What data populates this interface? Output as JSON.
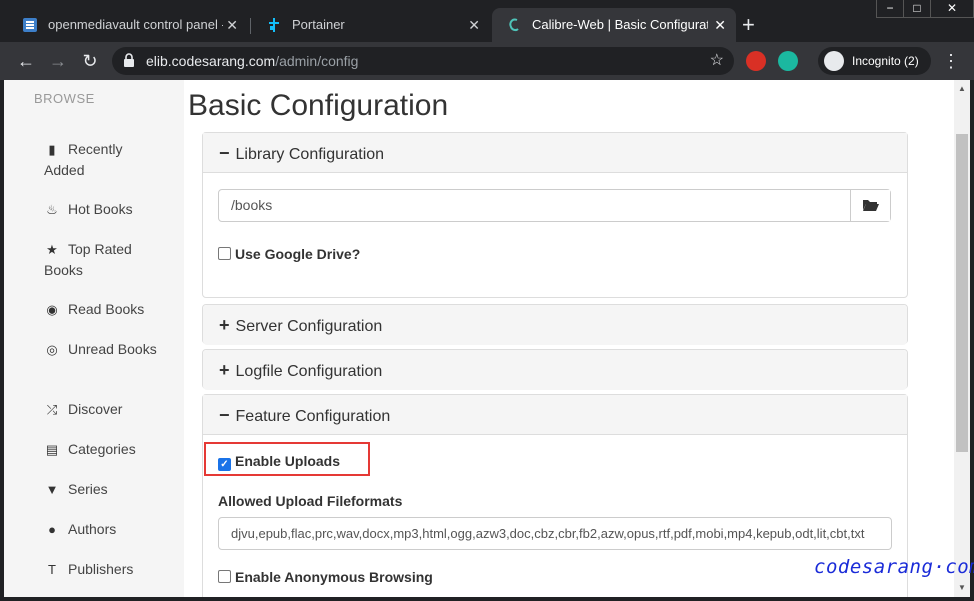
{
  "window_controls": {
    "minimize": "−",
    "maximize": "□",
    "close": "✕"
  },
  "tabs": [
    {
      "title": "openmediavault control panel - c",
      "icon": "omv-icon"
    },
    {
      "title": "Portainer",
      "icon": "portainer-icon"
    },
    {
      "title": "Calibre-Web | Basic Configuration",
      "icon": "calibre-icon"
    }
  ],
  "tab_close": "✕",
  "new_tab": "+",
  "toolbar": {
    "back": "←",
    "forward": "→",
    "reload": "↻",
    "url_host": "elib.codesarang.com",
    "url_path": "/admin/config",
    "star": "☆",
    "incognito_label": "Incognito (2)",
    "menu": "⋮"
  },
  "sidebar": {
    "heading": "BROWSE",
    "items": [
      {
        "label": "Recently Added",
        "icon": "book-icon",
        "glyph": "▮"
      },
      {
        "label": "Hot Books",
        "icon": "fire-icon",
        "glyph": "♨"
      },
      {
        "label": "Top Rated Books",
        "icon": "star-icon",
        "glyph": "★"
      },
      {
        "label": "Read Books",
        "icon": "eye-icon",
        "glyph": "◉"
      },
      {
        "label": "Unread Books",
        "icon": "eye-slash-icon",
        "glyph": "◎"
      },
      {
        "label": "Discover",
        "icon": "shuffle-icon",
        "glyph": "⤮"
      },
      {
        "label": "Categories",
        "icon": "inbox-icon",
        "glyph": "▤"
      },
      {
        "label": "Series",
        "icon": "bookmark-icon",
        "glyph": "▼"
      },
      {
        "label": "Authors",
        "icon": "user-icon",
        "glyph": "●"
      },
      {
        "label": "Publishers",
        "icon": "text-size-icon",
        "glyph": "T"
      }
    ]
  },
  "main": {
    "title": "Basic Configuration",
    "library": {
      "heading": "Library Configuration",
      "sign": "−",
      "path_value": "/books",
      "folder_glyph": "▬",
      "use_google_drive": "Use Google Drive?"
    },
    "server": {
      "heading": "Server Configuration",
      "sign": "+"
    },
    "logfile": {
      "heading": "Logfile Configuration",
      "sign": "+"
    },
    "feature": {
      "heading": "Feature Configuration",
      "sign": "−",
      "enable_uploads": "Enable Uploads",
      "enable_uploads_checked": true,
      "allowed_formats_label": "Allowed Upload Fileformats",
      "allowed_formats_value": "djvu,epub,flac,prc,wav,docx,mp3,html,ogg,azw3,doc,cbz,cbr,fb2,azw,opus,rtf,pdf,mobi,mp4,kepub,odt,lit,cbt,txt",
      "enable_anonymous": "Enable Anonymous Browsing"
    }
  },
  "watermark": "codesarang·com"
}
